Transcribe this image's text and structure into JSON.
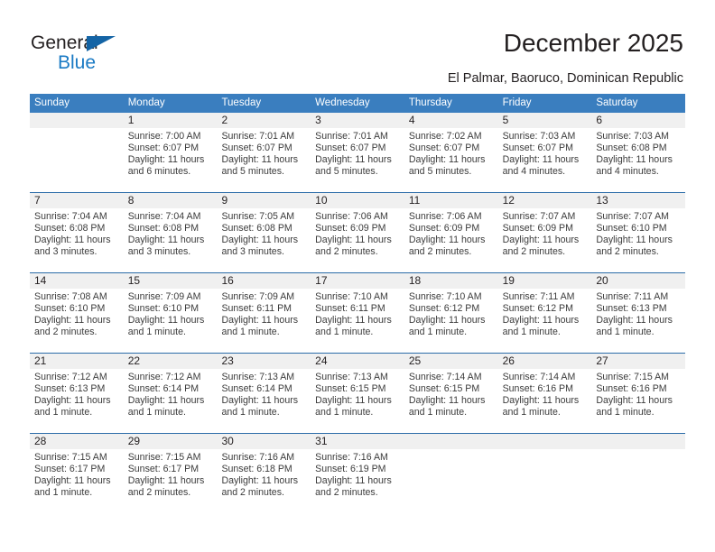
{
  "brand": {
    "name_part1": "General",
    "name_part2": "Blue",
    "triangle_color": "#1464a5",
    "blue_color": "#1a7ac4"
  },
  "header": {
    "title": "December 2025",
    "subtitle": "El Palmar, Baoruco, Dominican Republic"
  },
  "colors": {
    "header_blue": "#3a7ebf",
    "row_divider_blue": "#2b6ca8",
    "day_band_gray": "#f0f0f0",
    "text": "#231f20"
  },
  "weekdays": [
    "Sunday",
    "Monday",
    "Tuesday",
    "Wednesday",
    "Thursday",
    "Friday",
    "Saturday"
  ],
  "weeks": [
    [
      {
        "day": "",
        "lines": []
      },
      {
        "day": "1",
        "lines": [
          "Sunrise: 7:00 AM",
          "Sunset: 6:07 PM",
          "Daylight: 11 hours",
          "and 6 minutes."
        ]
      },
      {
        "day": "2",
        "lines": [
          "Sunrise: 7:01 AM",
          "Sunset: 6:07 PM",
          "Daylight: 11 hours",
          "and 5 minutes."
        ]
      },
      {
        "day": "3",
        "lines": [
          "Sunrise: 7:01 AM",
          "Sunset: 6:07 PM",
          "Daylight: 11 hours",
          "and 5 minutes."
        ]
      },
      {
        "day": "4",
        "lines": [
          "Sunrise: 7:02 AM",
          "Sunset: 6:07 PM",
          "Daylight: 11 hours",
          "and 5 minutes."
        ]
      },
      {
        "day": "5",
        "lines": [
          "Sunrise: 7:03 AM",
          "Sunset: 6:07 PM",
          "Daylight: 11 hours",
          "and 4 minutes."
        ]
      },
      {
        "day": "6",
        "lines": [
          "Sunrise: 7:03 AM",
          "Sunset: 6:08 PM",
          "Daylight: 11 hours",
          "and 4 minutes."
        ]
      }
    ],
    [
      {
        "day": "7",
        "lines": [
          "Sunrise: 7:04 AM",
          "Sunset: 6:08 PM",
          "Daylight: 11 hours",
          "and 3 minutes."
        ]
      },
      {
        "day": "8",
        "lines": [
          "Sunrise: 7:04 AM",
          "Sunset: 6:08 PM",
          "Daylight: 11 hours",
          "and 3 minutes."
        ]
      },
      {
        "day": "9",
        "lines": [
          "Sunrise: 7:05 AM",
          "Sunset: 6:08 PM",
          "Daylight: 11 hours",
          "and 3 minutes."
        ]
      },
      {
        "day": "10",
        "lines": [
          "Sunrise: 7:06 AM",
          "Sunset: 6:09 PM",
          "Daylight: 11 hours",
          "and 2 minutes."
        ]
      },
      {
        "day": "11",
        "lines": [
          "Sunrise: 7:06 AM",
          "Sunset: 6:09 PM",
          "Daylight: 11 hours",
          "and 2 minutes."
        ]
      },
      {
        "day": "12",
        "lines": [
          "Sunrise: 7:07 AM",
          "Sunset: 6:09 PM",
          "Daylight: 11 hours",
          "and 2 minutes."
        ]
      },
      {
        "day": "13",
        "lines": [
          "Sunrise: 7:07 AM",
          "Sunset: 6:10 PM",
          "Daylight: 11 hours",
          "and 2 minutes."
        ]
      }
    ],
    [
      {
        "day": "14",
        "lines": [
          "Sunrise: 7:08 AM",
          "Sunset: 6:10 PM",
          "Daylight: 11 hours",
          "and 2 minutes."
        ]
      },
      {
        "day": "15",
        "lines": [
          "Sunrise: 7:09 AM",
          "Sunset: 6:10 PM",
          "Daylight: 11 hours",
          "and 1 minute."
        ]
      },
      {
        "day": "16",
        "lines": [
          "Sunrise: 7:09 AM",
          "Sunset: 6:11 PM",
          "Daylight: 11 hours",
          "and 1 minute."
        ]
      },
      {
        "day": "17",
        "lines": [
          "Sunrise: 7:10 AM",
          "Sunset: 6:11 PM",
          "Daylight: 11 hours",
          "and 1 minute."
        ]
      },
      {
        "day": "18",
        "lines": [
          "Sunrise: 7:10 AM",
          "Sunset: 6:12 PM",
          "Daylight: 11 hours",
          "and 1 minute."
        ]
      },
      {
        "day": "19",
        "lines": [
          "Sunrise: 7:11 AM",
          "Sunset: 6:12 PM",
          "Daylight: 11 hours",
          "and 1 minute."
        ]
      },
      {
        "day": "20",
        "lines": [
          "Sunrise: 7:11 AM",
          "Sunset: 6:13 PM",
          "Daylight: 11 hours",
          "and 1 minute."
        ]
      }
    ],
    [
      {
        "day": "21",
        "lines": [
          "Sunrise: 7:12 AM",
          "Sunset: 6:13 PM",
          "Daylight: 11 hours",
          "and 1 minute."
        ]
      },
      {
        "day": "22",
        "lines": [
          "Sunrise: 7:12 AM",
          "Sunset: 6:14 PM",
          "Daylight: 11 hours",
          "and 1 minute."
        ]
      },
      {
        "day": "23",
        "lines": [
          "Sunrise: 7:13 AM",
          "Sunset: 6:14 PM",
          "Daylight: 11 hours",
          "and 1 minute."
        ]
      },
      {
        "day": "24",
        "lines": [
          "Sunrise: 7:13 AM",
          "Sunset: 6:15 PM",
          "Daylight: 11 hours",
          "and 1 minute."
        ]
      },
      {
        "day": "25",
        "lines": [
          "Sunrise: 7:14 AM",
          "Sunset: 6:15 PM",
          "Daylight: 11 hours",
          "and 1 minute."
        ]
      },
      {
        "day": "26",
        "lines": [
          "Sunrise: 7:14 AM",
          "Sunset: 6:16 PM",
          "Daylight: 11 hours",
          "and 1 minute."
        ]
      },
      {
        "day": "27",
        "lines": [
          "Sunrise: 7:15 AM",
          "Sunset: 6:16 PM",
          "Daylight: 11 hours",
          "and 1 minute."
        ]
      }
    ],
    [
      {
        "day": "28",
        "lines": [
          "Sunrise: 7:15 AM",
          "Sunset: 6:17 PM",
          "Daylight: 11 hours",
          "and 1 minute."
        ]
      },
      {
        "day": "29",
        "lines": [
          "Sunrise: 7:15 AM",
          "Sunset: 6:17 PM",
          "Daylight: 11 hours",
          "and 2 minutes."
        ]
      },
      {
        "day": "30",
        "lines": [
          "Sunrise: 7:16 AM",
          "Sunset: 6:18 PM",
          "Daylight: 11 hours",
          "and 2 minutes."
        ]
      },
      {
        "day": "31",
        "lines": [
          "Sunrise: 7:16 AM",
          "Sunset: 6:19 PM",
          "Daylight: 11 hours",
          "and 2 minutes."
        ]
      },
      {
        "day": "",
        "lines": []
      },
      {
        "day": "",
        "lines": []
      },
      {
        "day": "",
        "lines": []
      }
    ]
  ]
}
